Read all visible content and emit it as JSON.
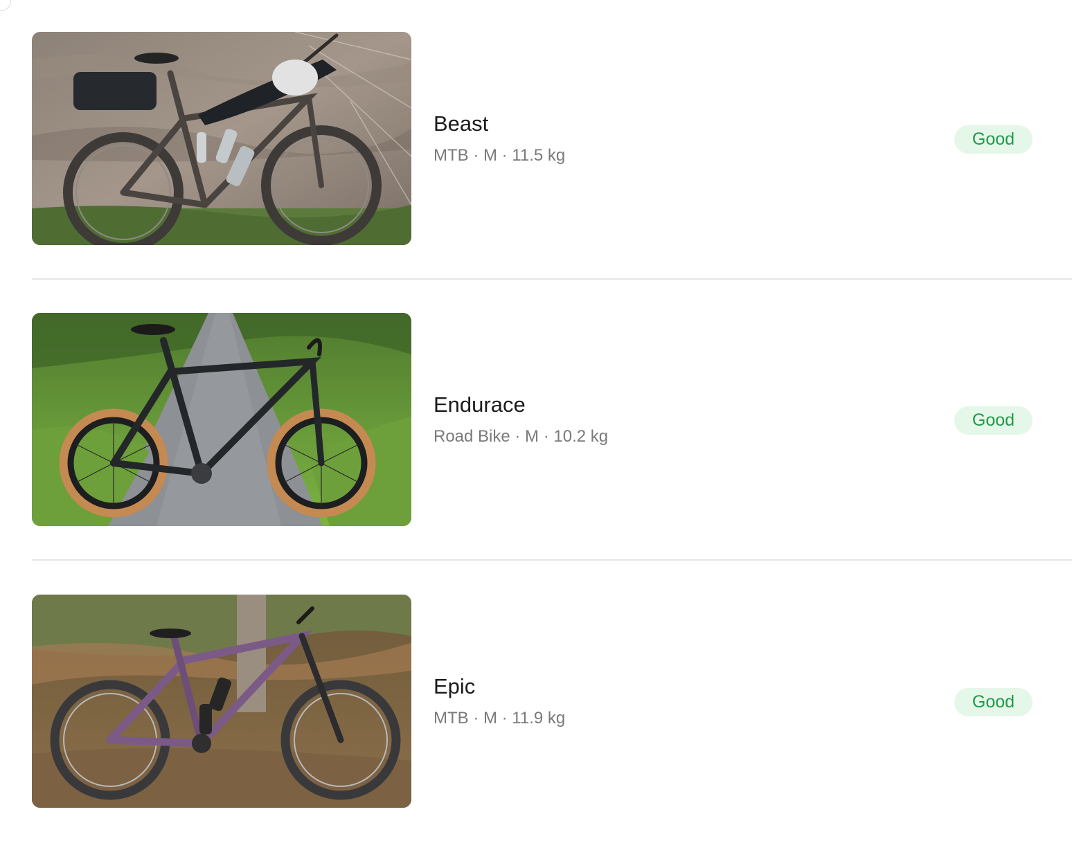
{
  "bikes": [
    {
      "name": "Beast",
      "type": "MTB",
      "size": "M",
      "weight": "11.5 kg",
      "meta": "MTB · M · 11.5 kg",
      "status": "Good",
      "photo_icon": "mountain-bike-photo"
    },
    {
      "name": "Endurace",
      "type": "Road Bike",
      "size": "M",
      "weight": "10.2 kg",
      "meta": "Road Bike · M · 10.2 kg",
      "status": "Good",
      "photo_icon": "road-bike-photo"
    },
    {
      "name": "Epic",
      "type": "MTB",
      "size": "M",
      "weight": "11.9 kg",
      "meta": "MTB · M · 11.9 kg",
      "status": "Good",
      "photo_icon": "full-suspension-bike-photo"
    }
  ],
  "colors": {
    "status_good_text": "#1f9a48",
    "status_good_bg": "#e5f7e9",
    "name_text": "#1b1b1b",
    "meta_text": "#7a7a7a",
    "divider": "#e6e6e6"
  }
}
